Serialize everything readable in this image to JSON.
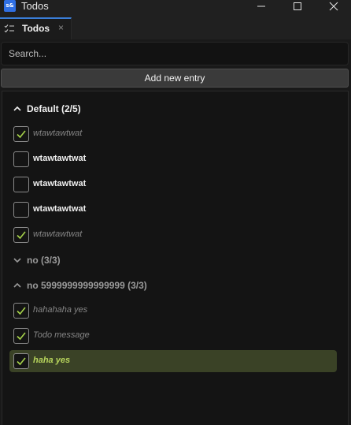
{
  "window": {
    "app_icon_text": "s&",
    "title": "Todos"
  },
  "tabs": [
    {
      "label": "Todos",
      "close": "×"
    }
  ],
  "search": {
    "placeholder": "Search..."
  },
  "add_button": {
    "label": "Add new entry"
  },
  "groups": [
    {
      "title": "Default (2/5)",
      "expanded": true,
      "items": [
        {
          "text": "wtawtawtwat",
          "done": true
        },
        {
          "text": "wtawtawtwat",
          "done": false
        },
        {
          "text": "wtawtawtwat",
          "done": false
        },
        {
          "text": "wtawtawtwat",
          "done": false
        },
        {
          "text": "wtawtawtwat",
          "done": true
        }
      ]
    },
    {
      "title": "no (3/3)",
      "expanded": false,
      "items": []
    },
    {
      "title": "no 5999999999999999 (3/3)",
      "expanded": true,
      "items": [
        {
          "text": "hahahaha yes",
          "done": true
        },
        {
          "text": "Todo message",
          "done": true
        },
        {
          "text": "haha yes",
          "done": true,
          "selected": true
        }
      ]
    }
  ],
  "colors": {
    "accent": "#3a7ed8",
    "check": "#a6d24a",
    "selected_bg": "#3a4226",
    "selected_text": "#b7d45c"
  }
}
